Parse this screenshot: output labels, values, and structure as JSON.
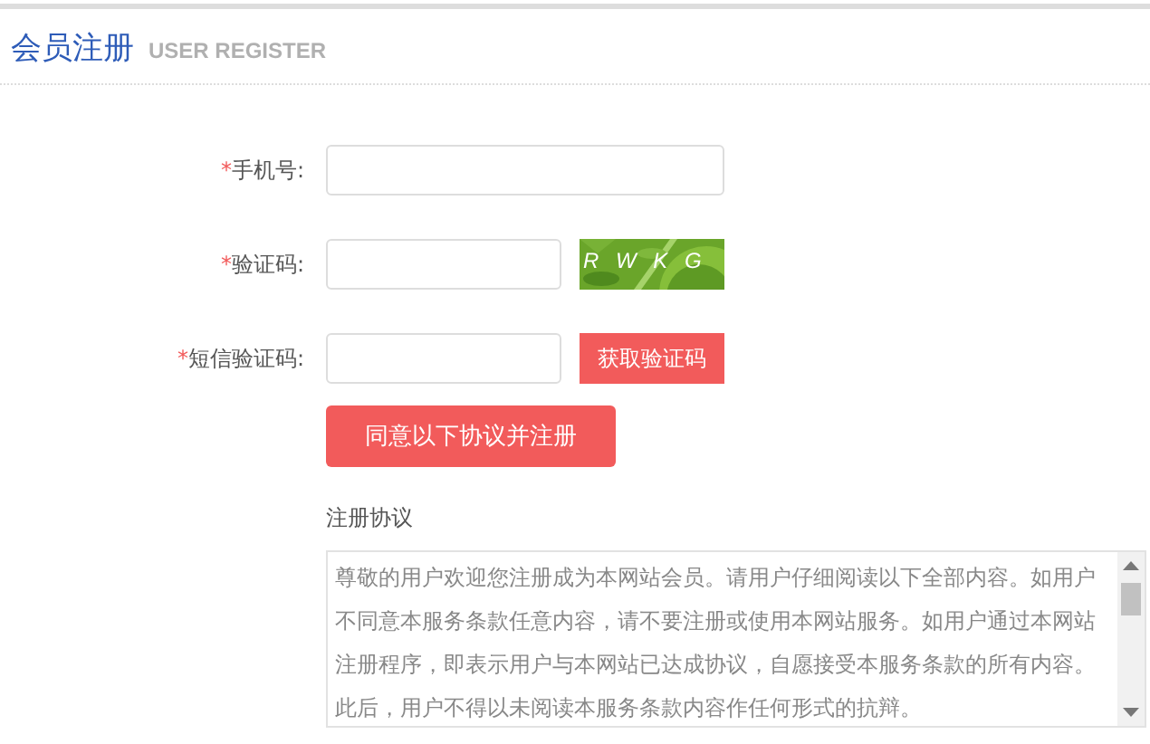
{
  "header": {
    "title": "会员注册",
    "subtitle": "USER REGISTER"
  },
  "fields": [
    {
      "kind": "text",
      "label": "手机号:",
      "required": true,
      "required_mark": "*"
    },
    {
      "kind": "captcha",
      "label": "验证码:",
      "required": true,
      "required_mark": "*",
      "captcha_text": "R W K G"
    },
    {
      "kind": "sms",
      "label": "短信验证码:",
      "required": true,
      "required_mark": "*",
      "button": "获取验证码"
    }
  ],
  "submit": "同意以下协议并注册",
  "agreement": {
    "title": "注册协议",
    "text": "尊敬的用户欢迎您注册成为本网站会员。请用户仔细阅读以下全部内容。如用户不同意本服务条款任意内容，请不要注册或使用本网站服务。如用户通过本网站注册程序，即表示用户与本网站已达成协议，自愿接受本服务条款的所有内容。此后，用户不得以未阅读本服务条款内容作任何形式的抗辩。"
  }
}
